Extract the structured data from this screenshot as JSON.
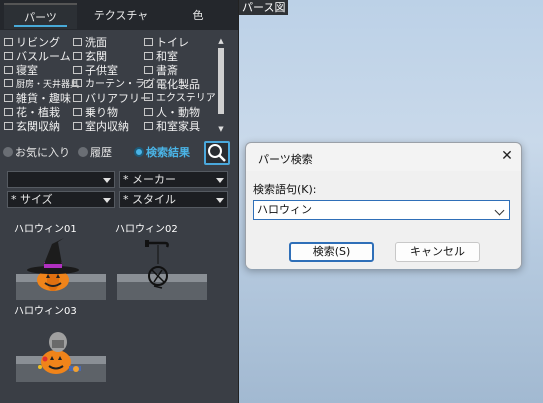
{
  "tabs": [
    {
      "label": "パーツ",
      "active": true
    },
    {
      "label": "テクスチャ",
      "active": false
    },
    {
      "label": "色",
      "active": false
    }
  ],
  "categories": [
    [
      "リビング",
      "洗面",
      "トイレ"
    ],
    [
      "バスルーム",
      "玄関",
      "和室"
    ],
    [
      "寝室",
      "子供室",
      "書斎"
    ],
    [
      "厨房・天井器具",
      "カーテン・ラグ",
      "電化製品"
    ],
    [
      "雑貨・趣味",
      "バリアフリー",
      "エクステリア"
    ],
    [
      "花・植栽",
      "乗り物",
      "人・動物"
    ],
    [
      "玄関収納",
      "室内収納",
      "和室家具"
    ]
  ],
  "modes": {
    "favorites": "お気に入り",
    "history": "履歴",
    "results": "検索結果"
  },
  "filters": {
    "first": "",
    "maker": "* メーカー",
    "size": "* サイズ",
    "style": "* スタイル"
  },
  "items": [
    {
      "label": "ハロウィン01"
    },
    {
      "label": "ハロウィン02"
    },
    {
      "label": "ハロウィン03"
    }
  ],
  "viewport": {
    "title": "パース図"
  },
  "dialog": {
    "title": "パーツ検索",
    "query_label": "検索語句(K):",
    "query_value": "ハロウィン",
    "search_button": "検索(S)",
    "cancel_button": "キャンセル"
  },
  "colors": {
    "accent": "#4ab4e6",
    "panel": "#3a3e45",
    "sky": "#c1d4e8"
  }
}
